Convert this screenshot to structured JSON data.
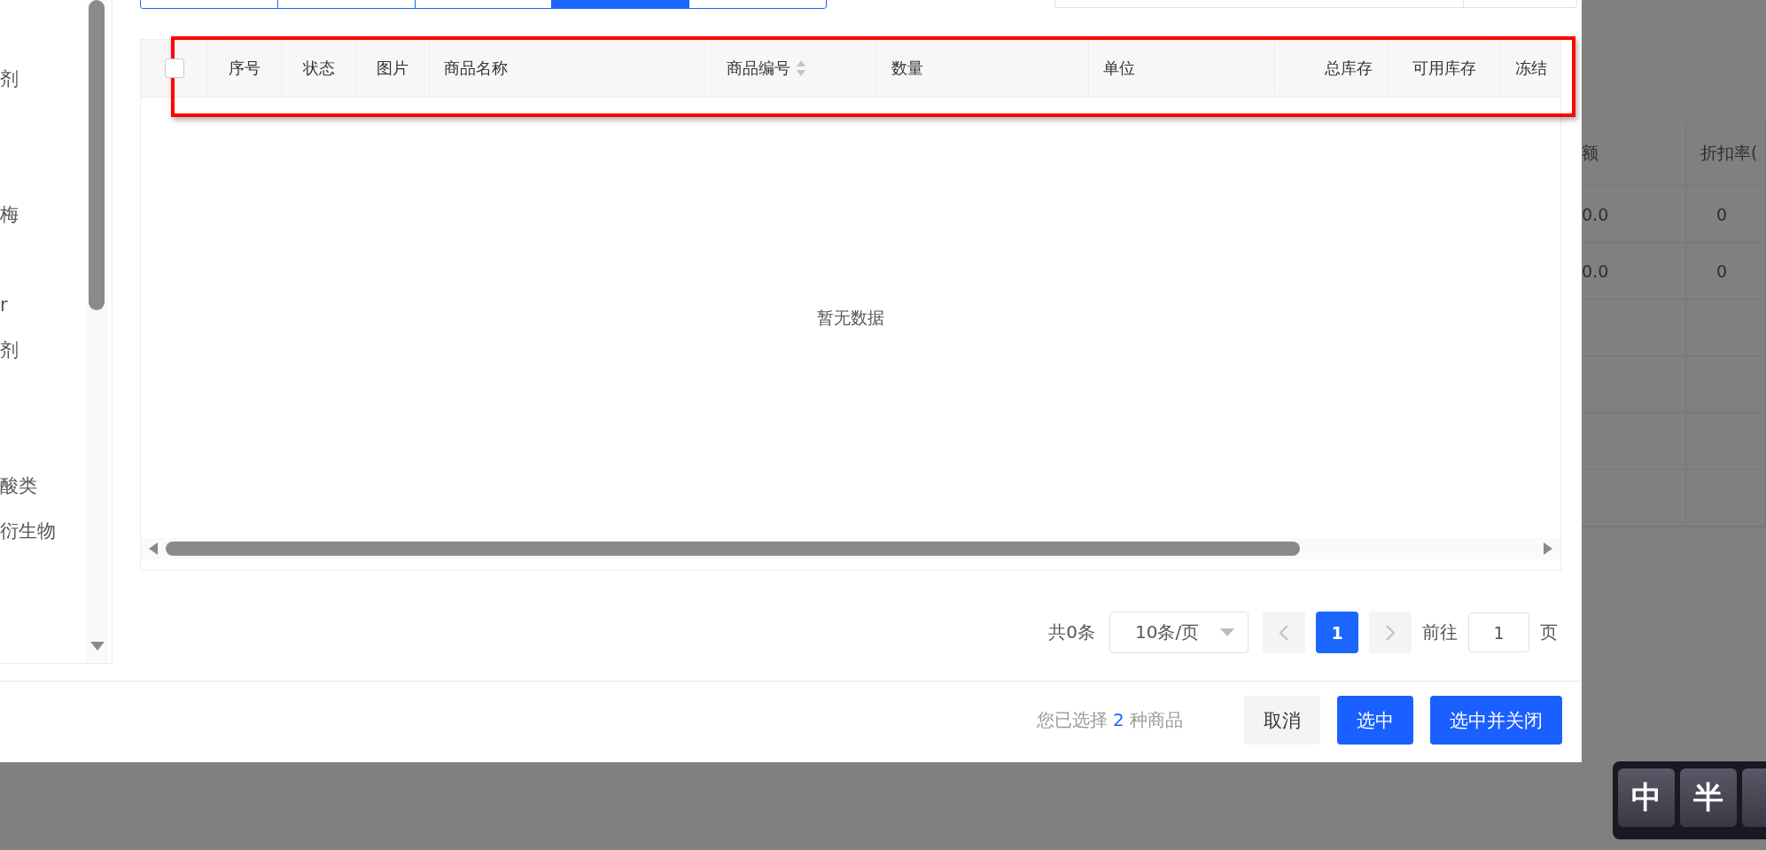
{
  "dialog": {
    "category_tree": {
      "items": [
        {
          "label": "剂"
        },
        {
          "label": "梅"
        },
        {
          "label": "r"
        },
        {
          "label": "剂"
        },
        {
          "label": "酸类"
        },
        {
          "label": "衍生物"
        }
      ]
    },
    "tabs": [
      {
        "selected": false
      },
      {
        "selected": false
      },
      {
        "selected": false
      },
      {
        "selected": true
      },
      {
        "selected": false
      }
    ],
    "table": {
      "columns": [
        {
          "kind": "checkbox",
          "checked": false
        },
        {
          "kind": "text",
          "label": "序号"
        },
        {
          "kind": "text",
          "label": "状态"
        },
        {
          "kind": "text",
          "label": "图片"
        },
        {
          "kind": "text",
          "label": "商品名称"
        },
        {
          "kind": "sortable",
          "label": "商品编号"
        },
        {
          "kind": "text",
          "label": "数量"
        },
        {
          "kind": "text",
          "label": "单位"
        },
        {
          "kind": "text",
          "label": "总库存"
        },
        {
          "kind": "text",
          "label": "可用库存"
        },
        {
          "kind": "text",
          "label": "冻结"
        }
      ],
      "empty_text": "暂无数据"
    },
    "pagination": {
      "total": "共0条",
      "page_size": "10条/页",
      "pages": [
        {
          "label": "1",
          "selected": true
        }
      ],
      "goto_label": "前往",
      "goto_value": "1",
      "goto_suffix": "页"
    },
    "footer": {
      "selection_prefix": "您已选择",
      "selection_count": "2",
      "selection_suffix": "种商品",
      "buttons": [
        {
          "label": "取消",
          "kind": "secondary"
        },
        {
          "label": "选中",
          "kind": "primary"
        },
        {
          "label": "选中并关闭",
          "kind": "primary"
        }
      ]
    }
  },
  "background_table": {
    "columns": [
      "额",
      "折扣率("
    ],
    "rows": [
      [
        "0.0",
        "0"
      ],
      [
        "0.0",
        "0"
      ]
    ]
  },
  "ime_toolbar": {
    "keys": [
      "中",
      "半"
    ]
  }
}
